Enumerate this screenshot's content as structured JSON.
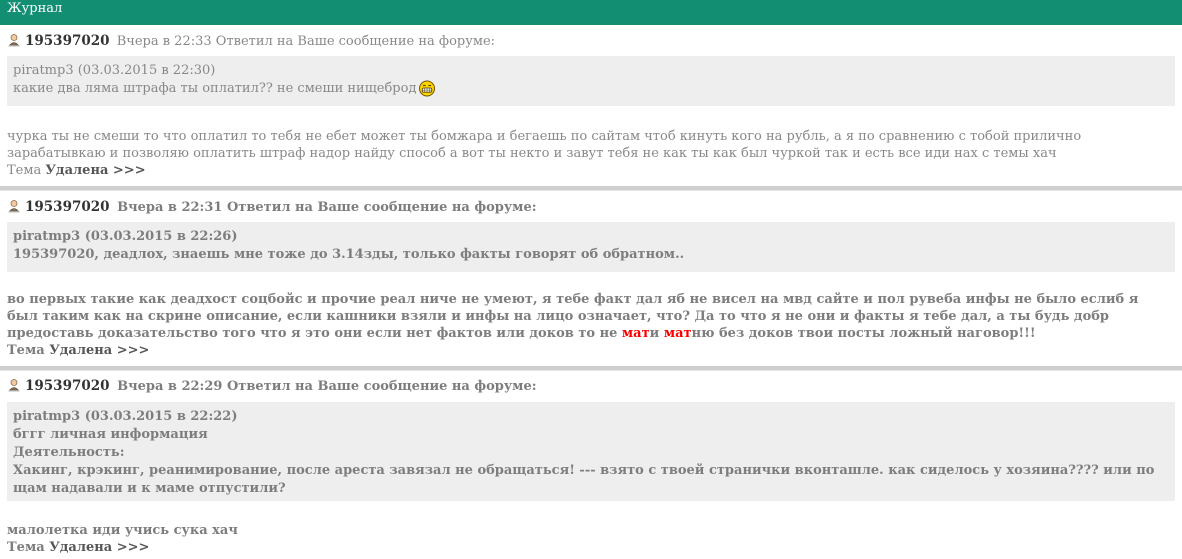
{
  "header": {
    "title": "Журнал"
  },
  "entries": [
    {
      "user_id": "195397020",
      "meta": "Вчера в 22:33 Ответил на Ваше сообщение на форуме:",
      "quote": {
        "author": "piratmp3 (03.03.2015 в 22:30)",
        "line1": "какие два ляма штрафа ты оплатил?? не смеши нищеброд"
      },
      "body": {
        "line1": "чурка ты не смеши то что оплатил то тебя не ебет может ты бомжара и бегаешь по сайтам чтоб кинуть кого на рубль, а я по сравнению с тобой прилично",
        "line2": "зарабатывкаю и позволяю оплатить штраф надор найду способ а вот ты некто и завут тебя не как ты как был чуркой так и есть все иди нах с темы хач"
      },
      "status_prefix": "Тема",
      "status_bold": "Удалена >>>"
    },
    {
      "user_id": "195397020",
      "meta": "Вчера в 22:31 Ответил на Ваше сообщение на форуме:",
      "quote": {
        "author": "piratmp3 (03.03.2015 в 22:26)",
        "line1": "195397020, деадлох, знаешь мне тоже до 3.14зды, только факты говорят об обратном.."
      },
      "body": {
        "line1": "во первых такие как деадхост соцбойс и прочие реал ниче не умеют, я тебе факт дал яб не висел на мвд сайте и пол рувеба инфы не было еслиб я",
        "line2": "был таким как на скрине описание, если кашники взяли и инфы на лицо означает, что? Да то что я не они и факты я тебе дал, а ты будь добр",
        "line3_start": "предоставь доказательство того что я это они если нет фактов или доков то не ",
        "line3_swear1": "мат",
        "line3_mid1": "и ",
        "line3_swear2": "мат",
        "line3_end": "ню без доков твои посты ложный наговор!!!"
      },
      "status_prefix": "Тема",
      "status_bold": "Удалена >>>"
    },
    {
      "user_id": "195397020",
      "meta": "Вчера в 22:29 Ответил на Ваше сообщение на форуме:",
      "quote": {
        "author": "piratmp3 (03.03.2015 в 22:22)",
        "line1": "бггг личная информация",
        "line2": "Деятельность:",
        "line3": "Хакинг, крэкинг, реанимирование, после ареста завязал не обращаться! --- взято с твоей странички вконташле. как сиделось у хозяина???? или по",
        "line4": "щам надавали и к маме отпустили?"
      },
      "body": {
        "line1": "малолетка иди учись сука хач"
      },
      "status_prefix": "Тема",
      "status_bold": "Удалена >>>"
    }
  ]
}
